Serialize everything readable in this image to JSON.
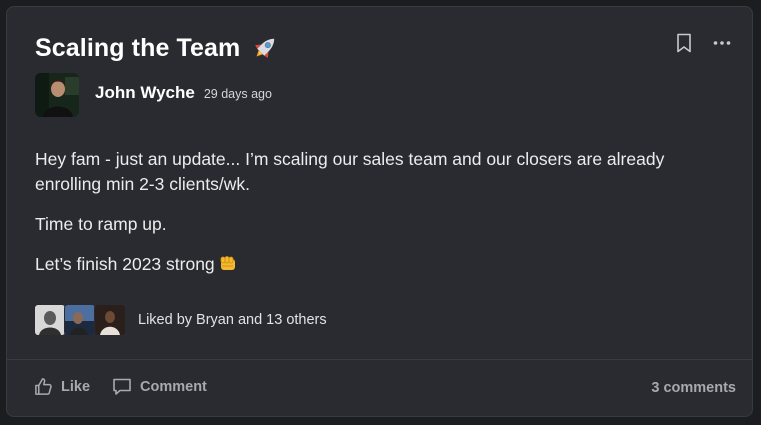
{
  "post": {
    "title": "Scaling the Team",
    "title_emoji": "rocket-emoji",
    "author": "John Wyche",
    "time_ago": "29 days ago",
    "paragraphs": [
      "Hey fam - just an update... I’m scaling our sales team and our closers are already enrolling min 2-3 clients/wk.",
      "Time to ramp up.",
      "Let’s finish 2023 strong"
    ],
    "final_emoji": "fist-bump-emoji"
  },
  "likes": {
    "text": "Liked by Bryan and 13 others"
  },
  "actions": {
    "like": "Like",
    "comment": "Comment",
    "comments_count": "3 comments"
  },
  "icons": {
    "bookmark": "bookmark-icon",
    "more": "more-dots-icon",
    "like": "thumbs-up-icon",
    "comment": "comment-bubble-icon"
  },
  "colors": {
    "background": "#1c1d20",
    "card": "#2a2b30",
    "text_primary": "#ffffff",
    "text_muted": "#a8a9b0"
  }
}
